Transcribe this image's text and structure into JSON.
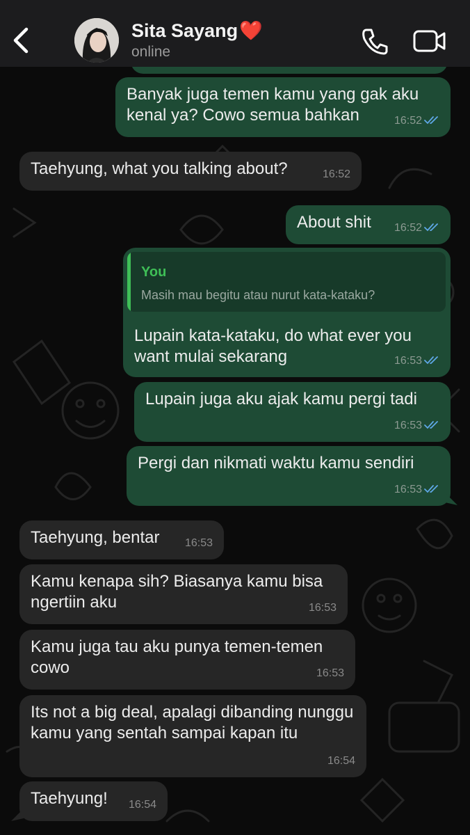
{
  "header": {
    "back_icon": "chevron-left-icon",
    "contact_name": "Sita Sayang",
    "name_emoji": "❤️",
    "status": "online",
    "call_icon": "phone-icon",
    "video_icon": "video-camera-icon"
  },
  "colors": {
    "outgoing_bubble": "#1e4b35",
    "incoming_bubble": "#262626",
    "read_ticks": "#5fa8e8",
    "quote_accent": "#3fbf57"
  },
  "messages": [
    {
      "dir": "out",
      "text": "Banyak juga temen kamu yang gak aku kenal ya? Cowo semua bahkan",
      "time": "16:52",
      "read": true
    },
    {
      "dir": "in",
      "text": "Taehyung, what you talking about?",
      "time": "16:52"
    },
    {
      "dir": "out",
      "text": "About shit",
      "time": "16:52",
      "read": true
    },
    {
      "dir": "out",
      "text": "Lupain kata-kataku, do what ever you want mulai sekarang",
      "time": "16:53",
      "read": true,
      "reply_to": {
        "author": "You",
        "text": "Masih mau begitu atau nurut kata-kataku?"
      }
    },
    {
      "dir": "out",
      "text": "Lupain juga aku ajak kamu pergi tadi",
      "time": "16:53",
      "read": true
    },
    {
      "dir": "out",
      "text": "Pergi dan nikmati waktu kamu sendiri",
      "time": "16:53",
      "read": true
    },
    {
      "dir": "in",
      "text": "Taehyung, bentar",
      "time": "16:53"
    },
    {
      "dir": "in",
      "text": "Kamu kenapa sih? Biasanya kamu bisa ngertiin aku",
      "time": "16:53"
    },
    {
      "dir": "in",
      "text": "Kamu juga tau aku punya temen-temen cowo",
      "time": "16:53"
    },
    {
      "dir": "in",
      "text": "Its not a big deal, apalagi dibanding nunggu kamu yang sentah sampai kapan itu",
      "time": "16:54"
    },
    {
      "dir": "in",
      "text": "Taehyung!",
      "time": "16:54"
    }
  ]
}
